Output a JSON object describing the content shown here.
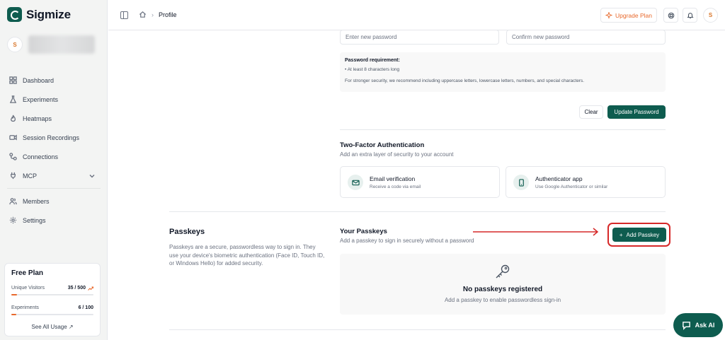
{
  "brand": {
    "name": "Sigmize",
    "accent": "#0e5c4f",
    "highlight": "#d62828"
  },
  "user": {
    "initial": "S"
  },
  "sidebar": {
    "items": [
      {
        "label": "Dashboard",
        "icon": "grid-icon"
      },
      {
        "label": "Experiments",
        "icon": "flask-icon"
      },
      {
        "label": "Heatmaps",
        "icon": "flame-icon"
      },
      {
        "label": "Session Recordings",
        "icon": "video-icon"
      },
      {
        "label": "Connections",
        "icon": "link-icon"
      },
      {
        "label": "MCP",
        "icon": "plug-icon"
      },
      {
        "label": "Members",
        "icon": "users-icon"
      },
      {
        "label": "Settings",
        "icon": "gear-icon"
      }
    ]
  },
  "plan": {
    "title": "Free Plan",
    "visitors_label": "Unique Visitors",
    "visitors_value": "35 / 500",
    "visitors_fraction": 0.07,
    "experiments_label": "Experiments",
    "experiments_value": "6 / 100",
    "experiments_fraction": 0.06,
    "see_usage": "See All Usage ↗"
  },
  "topbar": {
    "breadcrumb": "Profile",
    "upgrade_label": "Upgrade Plan"
  },
  "password": {
    "new_placeholder": "Enter new password",
    "confirm_placeholder": "Confirm new password",
    "req_title": "Password requirement:",
    "req_item": "• At least 8 characters long",
    "req_note": "For stronger security, we recommend including uppercase letters, lowercase letters, numbers, and special characters.",
    "clear_label": "Clear",
    "update_label": "Update Password"
  },
  "twofa": {
    "title": "Two-Factor Authentication",
    "subtitle": "Add an extra layer of security to your account",
    "email_title": "Email verification",
    "email_sub": "Receive a code via email",
    "app_title": "Authenticator app",
    "app_sub": "Use Google Authenticator or similar"
  },
  "passkeys": {
    "title": "Passkeys",
    "description": "Passkeys are a secure, passwordless way to sign in. They use your device's biometric authentication (Face ID, Touch ID, or Windows Hello) for added security.",
    "your_title": "Your Passkeys",
    "your_sub": "Add a passkey to sign in securely without a password",
    "add_label": "Add Passkey",
    "empty_title": "No passkeys registered",
    "empty_sub": "Add a passkey to enable passwordless sign-in"
  },
  "ask_ai": {
    "label": "Ask AI"
  }
}
